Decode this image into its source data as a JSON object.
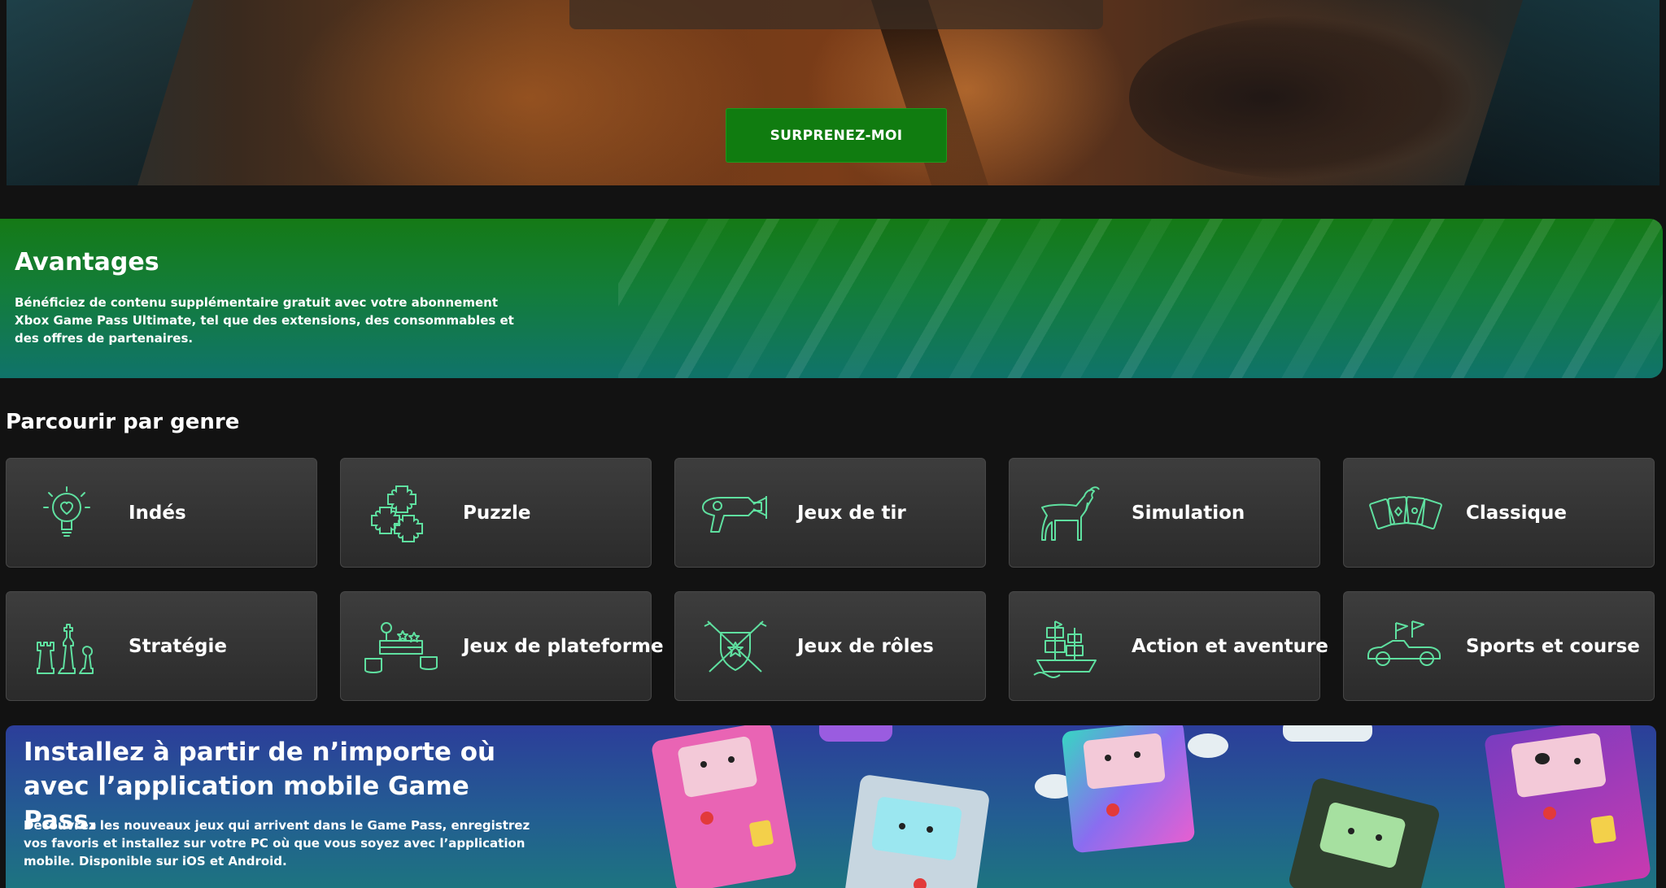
{
  "hero": {
    "cta_label": "SURPRENEZ-MOI"
  },
  "perks": {
    "title": "Avantages",
    "description": "Bénéficiez de contenu supplémentaire gratuit avec votre abonnement Xbox Game Pass Ultimate, tel que des extensions, des consommables et des offres de partenaires."
  },
  "genres": {
    "title": "Parcourir par genre",
    "items": [
      {
        "label": "Indés",
        "icon": "lightbulb-heart-icon"
      },
      {
        "label": "Puzzle",
        "icon": "puzzle-icon"
      },
      {
        "label": "Jeux de tir",
        "icon": "ray-gun-icon"
      },
      {
        "label": "Simulation",
        "icon": "goat-icon"
      },
      {
        "label": "Classique",
        "icon": "playing-cards-icon"
      },
      {
        "label": "Stratégie",
        "icon": "chess-pieces-icon"
      },
      {
        "label": "Jeux de plateforme",
        "icon": "platform-blocks-icon"
      },
      {
        "label": "Jeux de rôles",
        "icon": "shield-swords-icon"
      },
      {
        "label": "Action et aventure",
        "icon": "pirate-ship-icon"
      },
      {
        "label": "Sports et course",
        "icon": "race-car-icon"
      }
    ]
  },
  "promo": {
    "title": "Installez à partir de n’importe où avec l’application mobile Game Pass.",
    "description": "Découvrez les nouveaux jeux qui arrivent dans le Game Pass, enregistrez vos favoris et installez sur votre PC où que vous soyez avec l’application mobile. Disponible sur iOS et Android."
  },
  "colors": {
    "accent_green": "#107c10",
    "icon_green": "#5fe0a0",
    "page_bg": "#121212"
  }
}
